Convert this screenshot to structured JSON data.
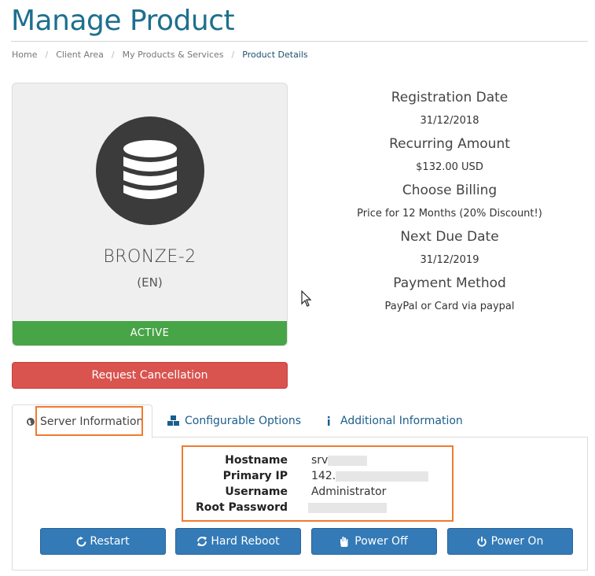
{
  "page": {
    "title": "Manage Product"
  },
  "breadcrumb": {
    "items": [
      {
        "label": "Home"
      },
      {
        "label": "Client Area"
      },
      {
        "label": "My Products & Services"
      },
      {
        "label": "Product Details"
      }
    ],
    "separator": "/"
  },
  "product": {
    "icon": "database-icon",
    "name": "BRONZE-2",
    "group": "(EN)",
    "status": "ACTIVE",
    "status_color": "#47a447"
  },
  "cancel_button": {
    "label": "Request Cancellation",
    "color": "#d9534f"
  },
  "details": [
    {
      "label": "Registration Date",
      "value": "31/12/2018"
    },
    {
      "label": "Recurring Amount",
      "value": "$132.00 USD"
    },
    {
      "label": "Choose Billing",
      "value": "Price for 12 Months (20% Discount!)"
    },
    {
      "label": "Next Due Date",
      "value": "31/12/2019"
    },
    {
      "label": "Payment Method",
      "value": "PayPal or Card via paypal"
    }
  ],
  "tabs": [
    {
      "label": "Server Information",
      "icon": "globe-icon",
      "active": true
    },
    {
      "label": "Configurable Options",
      "icon": "cubes-icon",
      "active": false
    },
    {
      "label": "Additional Information",
      "icon": "info-icon",
      "active": false
    }
  ],
  "server_info": {
    "hostname_label": "Hostname",
    "hostname_value": "srv",
    "primary_ip_label": "Primary IP",
    "primary_ip_value": "142.",
    "username_label": "Username",
    "username_value": "Administrator",
    "root_password_label": "Root Password"
  },
  "actions": [
    {
      "label": "Restart",
      "icon": "refresh-icon"
    },
    {
      "label": "Hard Reboot",
      "icon": "refresh-icon"
    },
    {
      "label": "Power Off",
      "icon": "hand-stop-icon"
    },
    {
      "label": "Power On",
      "icon": "power-icon"
    }
  ],
  "colors": {
    "accent": "#1e6f8e",
    "link": "#1b5e8c",
    "primary_button": "#337ab7",
    "highlight": "#f07b2e"
  }
}
